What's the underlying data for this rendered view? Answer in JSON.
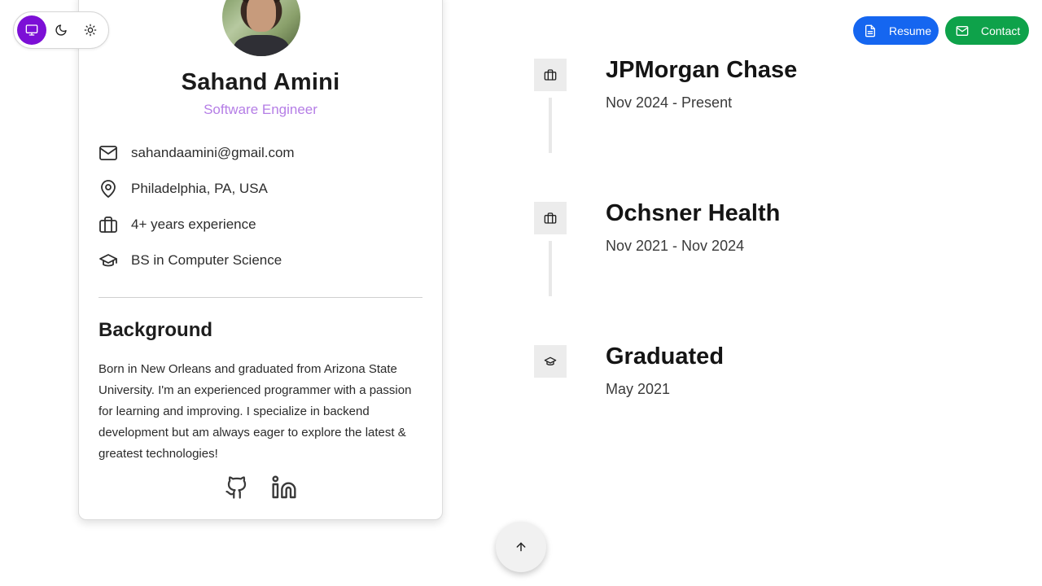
{
  "theme_switcher": {
    "options": [
      {
        "icon": "monitor-icon",
        "active": true
      },
      {
        "icon": "moon-icon",
        "active": false
      },
      {
        "icon": "sun-icon",
        "active": false
      }
    ],
    "active_color": "#7c0fd6"
  },
  "profile": {
    "name": "Sahand Amini",
    "role": "Software Engineer",
    "role_color": "#b57ee6",
    "details": [
      {
        "icon": "mail-icon",
        "text": "sahandaamini@gmail.com"
      },
      {
        "icon": "map-pin-icon",
        "text": "Philadelphia, PA, USA"
      },
      {
        "icon": "briefcase-icon",
        "text": "4+ years experience"
      },
      {
        "icon": "graduation-cap-icon",
        "text": "BS in Computer Science"
      }
    ],
    "background_title": "Background",
    "background_text": "Born in New Orleans and graduated from Arizona State University. I'm an experienced programmer with a passion for learning and improving. I specialize in backend development but am always eager to explore the latest & greatest technologies!",
    "socials": [
      {
        "icon": "github-icon"
      },
      {
        "icon": "linkedin-icon"
      }
    ]
  },
  "header_buttons": {
    "resume_label": "Resume",
    "contact_label": "Contact",
    "resume_color": "#1566f0",
    "contact_color": "#0ea24a"
  },
  "timeline": [
    {
      "icon": "briefcase-icon",
      "title": "JPMorgan Chase",
      "date": "Nov 2024 - Present"
    },
    {
      "icon": "briefcase-icon",
      "title": "Ochsner Health",
      "date": "Nov 2021 - Nov 2024"
    },
    {
      "icon": "graduation-cap-icon",
      "title": "Graduated",
      "date": "May 2021"
    }
  ],
  "scroll_top": {
    "icon": "arrow-up-icon"
  }
}
